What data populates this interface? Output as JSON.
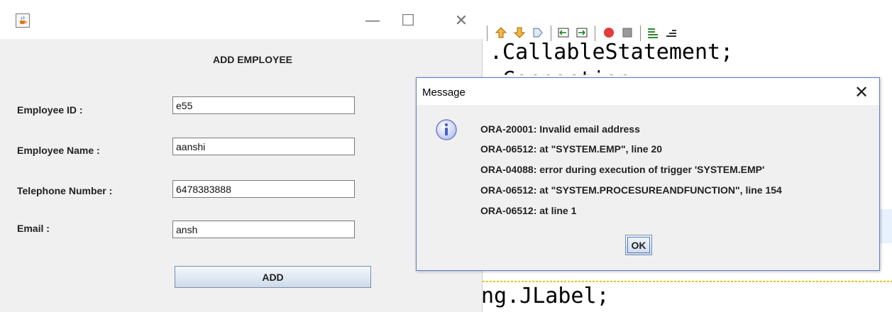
{
  "ide": {
    "code_lines": [
      ".CallableStatement;",
      ".Connection;",
      "ng.JLabel;"
    ],
    "toolbar_icons": [
      "up-arrow-icon",
      "down-arrow-icon",
      "step-icon",
      "step-back-icon",
      "step-forward-icon",
      "record-icon",
      "stop-icon",
      "format-icon",
      "align-icon"
    ]
  },
  "app_window": {
    "minimize_glyph": "—",
    "maximize_glyph": "☐",
    "close_glyph": "✕",
    "form_title": "ADD EMPLOYEE",
    "fields": {
      "employee_id": {
        "label": "Employee ID :",
        "value": "e55"
      },
      "employee_name": {
        "label": "Employee Name :",
        "value": "aanshi"
      },
      "telephone": {
        "label": "Telephone Number :",
        "value": "6478383888"
      },
      "email": {
        "label": "Email :",
        "value": "ansh"
      }
    },
    "add_button": "ADD"
  },
  "dialog": {
    "title": "Message",
    "close_glyph": "✕",
    "messages": [
      "ORA-20001: Invalid email address",
      "ORA-06512: at \"SYSTEM.EMP\", line 20",
      "ORA-04088: error during execution of trigger 'SYSTEM.EMP'",
      "ORA-06512: at \"SYSTEM.PROCESUREANDFUNCTION\", line 154",
      "ORA-06512: at line 1"
    ],
    "ok_button": "OK"
  },
  "colors": {
    "dialog_border": "#5a7dc6",
    "window_bg": "#f0f0f0",
    "info_icon": "#6b7fd1"
  }
}
